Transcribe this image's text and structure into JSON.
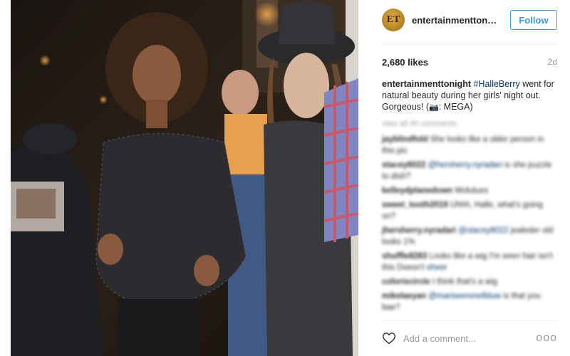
{
  "post": {
    "image_alt": "Photo"
  },
  "header": {
    "avatar_text": "ET",
    "username": "entertainmenttonight",
    "follow_label": "Follow"
  },
  "stats": {
    "likes": "2,680 likes",
    "time": "2d"
  },
  "caption": {
    "user": "entertainmenttonight",
    "hashtag": "#HalleBerry",
    "text": " went for natural beauty during her girls' night out. Gorgeous! (",
    "camera": "📷",
    "credit": ": MEGA)"
  },
  "comments": {
    "load_more": "view all 40 comments",
    "items": [
      {
        "user": "jayblindfold",
        "mention": "",
        "text": " She looks like a older person in this pic"
      },
      {
        "user": "stacey8022",
        "mention": "@hersherry.nyradari",
        "text": " is she puzzle to dish?"
      },
      {
        "user": "kelleydplanedown",
        "mention": "",
        "text": " Wolulues"
      },
      {
        "user": "sweet_tooth2019",
        "mention": "",
        "text": " Uhhh, Halle, what's going on?"
      },
      {
        "user": "jhersherry.nyradari",
        "mention": "@stacey8022",
        "text": " jealeder old looks 1%"
      },
      {
        "user": "shuffle8283",
        "mention": "",
        "text": " Looks like a wig I'm seen hair isn't this Doesn't ",
        "tail": "sheer"
      },
      {
        "user": "coloriscircle",
        "mention": "",
        "text": " I think that's a wig"
      },
      {
        "user": "mikelaeyan",
        "mention": "@mariseerenellduw",
        "text": " is that you bae?"
      }
    ]
  },
  "comment_bar": {
    "placeholder": "Add a comment...",
    "more_label": "ooo"
  }
}
